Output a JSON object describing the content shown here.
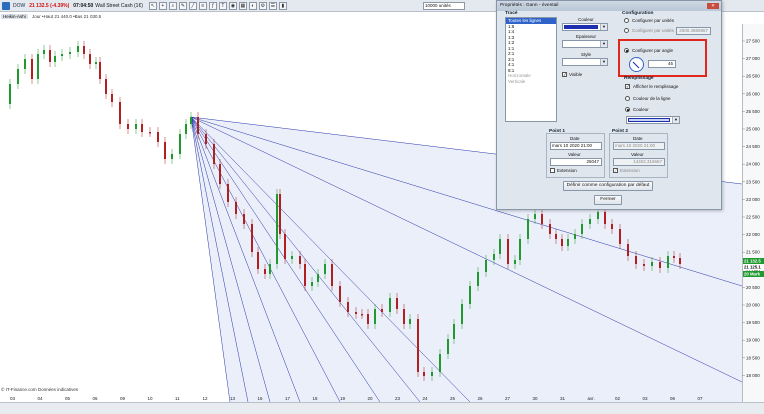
{
  "toolbar": {
    "symbol": "DOW",
    "change": "21 132.5 (-4.39%)",
    "time": "07:04:50",
    "name": "Wall Street Cash (1€)",
    "units": "10000 unités",
    "icons": [
      "cursor-icon",
      "crosshair-icon",
      "zoom-icon",
      "pen-icon",
      "line-icon",
      "channel-icon",
      "fibonacci-icon",
      "text-icon",
      "eye-icon",
      "grid-icon",
      "color-icon",
      "settings-icon",
      "list-icon",
      "bars-icon"
    ]
  },
  "chart": {
    "title": "Heikin-Ashi",
    "info": "Jour  •Haut 21 440.0  •Bas 21 030.5",
    "source": "© IT-Finance.com  Données indicatives",
    "price_labels": [
      "27 500",
      "27 000",
      "26 500",
      "26 000",
      "25 500",
      "25 000",
      "24 500",
      "24 000",
      "23 500",
      "23 000",
      "22 500",
      "22 000",
      "21 500",
      "21 000",
      "20 500",
      "20 000",
      "19 500",
      "19 000",
      "18 500",
      "18 000"
    ],
    "current_price": "21 132.5",
    "secondary_price": "21 125.1",
    "secondary_tag": "20 Mark",
    "date_labels": [
      "03",
      "04",
      "05",
      "06",
      "09",
      "10",
      "11",
      "12",
      "13",
      "16",
      "17",
      "18",
      "19",
      "20",
      "23",
      "24",
      "25",
      "26",
      "27",
      "30",
      "31",
      "avr.",
      "02",
      "03",
      "06",
      "07"
    ],
    "colors": {
      "up": "#1f9a2e",
      "down": "#b02020",
      "gann": "#2434a8",
      "fan_fill": "#e4e9f8"
    }
  },
  "dialog": {
    "title": "Propriétés : Gann - éventail",
    "close_label": "✕",
    "trace_label": "Tracé",
    "list_items": [
      "Toutes les lignes",
      "1:8",
      "1:4",
      "1:3",
      "1:2",
      "1:1",
      "2:1",
      "3:1",
      "4:1",
      "8:1",
      "Horizontale",
      "Verticale"
    ],
    "couleur_label": "Couleur",
    "epaisseur_label": "Epaisseur",
    "style_label": "Style",
    "visible_label": "Visible",
    "config_label": "Configuration",
    "config_units_label": "Configurer par unités",
    "config_price_label": "Configurer par unités",
    "config_price_value": "2000.4866967",
    "config_angle_label": "Configurer par angle",
    "angle_value": "45",
    "remplissage_label": "Remplissage",
    "afficher_label": "Afficher le remplissage",
    "couleur_ligne_label": "Couleur de la ligne",
    "couleur_label2": "Couleur",
    "point1_label": "Point 1",
    "point2_label": "Point 2",
    "date_label": "Date",
    "valeur_label": "Valeur",
    "p1_date": "mars 10 2020 21:00",
    "p1_value": "25047",
    "p2_date": "mars 10 2020 21:00",
    "p2_value": "14402.316667",
    "extension_label": "Extension",
    "default_button": "Définir comme configuration par défaut",
    "close_button": "Fermer"
  }
}
